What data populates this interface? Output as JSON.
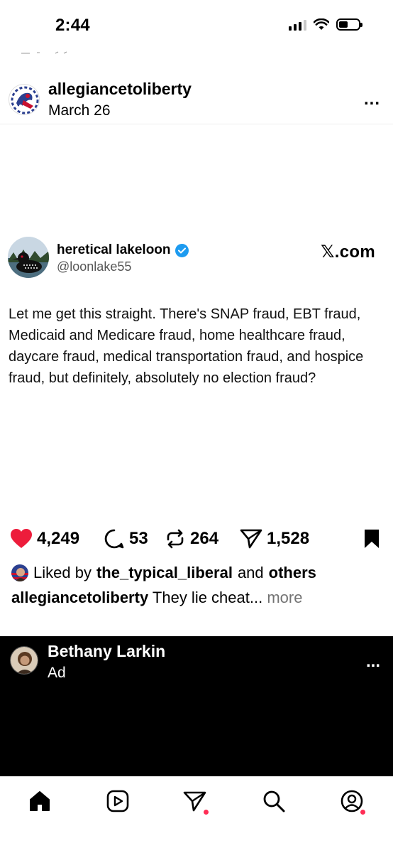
{
  "status_bar": {
    "time": "2:44"
  },
  "post": {
    "username": "allegiancetoliberty",
    "date": "March 26",
    "more_label": "..."
  },
  "tweet": {
    "display_name": "heretical lakeloon",
    "handle": "@loonlake55",
    "source": "𝕏.com",
    "text": "Let me get this straight. There's SNAP fraud, EBT fraud, Medicaid and Medicare fraud, home healthcare fraud, daycare fraud, medical transportation fraud, and hospice fraud, but definitely, absolutely no election fraud?"
  },
  "actions": {
    "likes": "4,249",
    "comments": "53",
    "reposts": "264",
    "shares": "1,528"
  },
  "liked_by": {
    "prefix": "Liked by",
    "user": "the_typical_liberal",
    "joiner": "and",
    "others": "others"
  },
  "caption": {
    "username": "allegiancetoliberty",
    "text": "They lie cheat...",
    "more": "more"
  },
  "ad": {
    "name": "Bethany Larkin",
    "label": "Ad",
    "more_label": "..."
  },
  "colors": {
    "like_red": "#ed1c3b",
    "verified_blue": "#1d9bf0",
    "notify_dot": "#ff2d55"
  },
  "icons": {
    "status": [
      "signal-icon",
      "wifi-icon",
      "battery-icon"
    ],
    "nav": [
      "home-icon",
      "reels-icon",
      "messages-icon",
      "search-icon",
      "profile-icon"
    ]
  }
}
